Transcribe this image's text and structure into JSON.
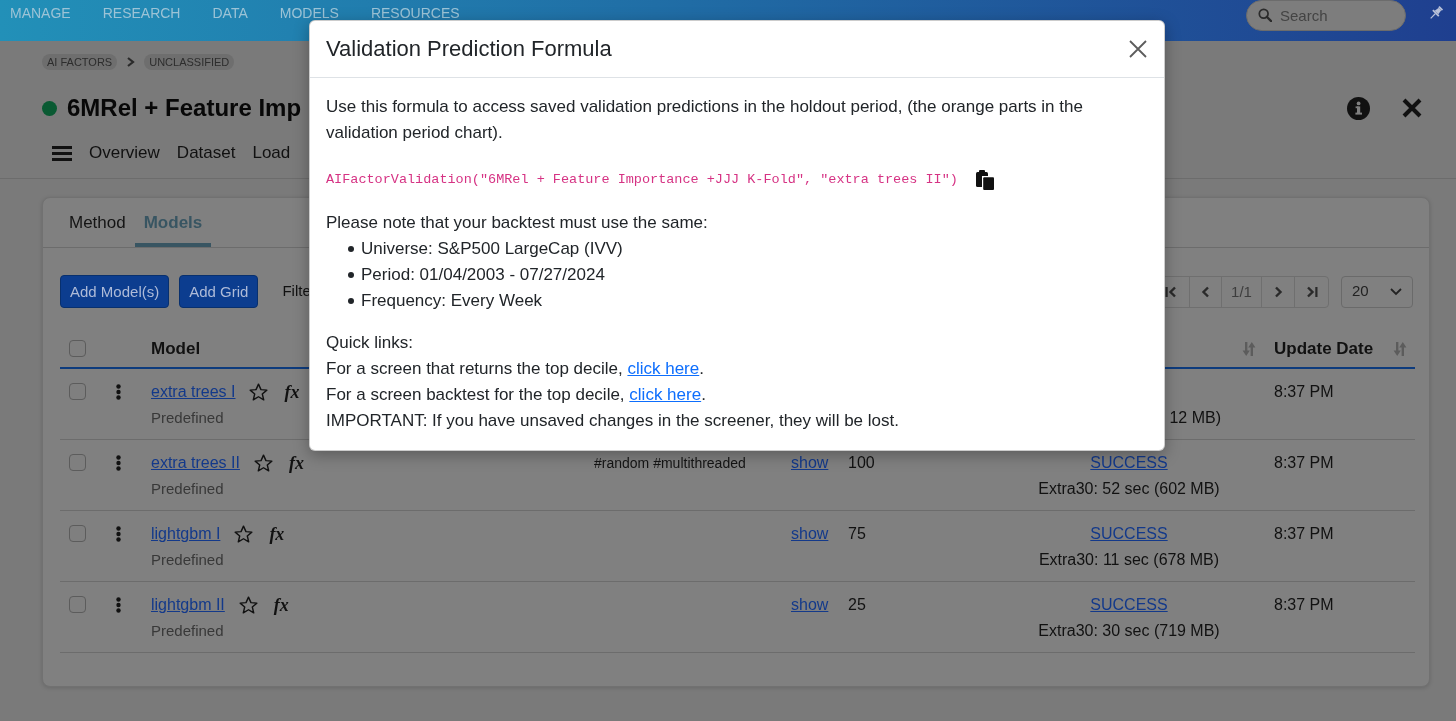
{
  "navbar": {
    "items": [
      "MANAGE",
      "RESEARCH",
      "DATA",
      "MODELS",
      "RESOURCES"
    ],
    "search": {
      "placeholder": "Search"
    }
  },
  "breadcrumb": [
    "AI FACTORS",
    "UNCLASSIFIED"
  ],
  "page": {
    "title": "6MRel + Feature Imp",
    "tabs": [
      "Overview",
      "Dataset",
      "Load"
    ]
  },
  "card": {
    "tabs": [
      {
        "label": "Method",
        "selected": false
      },
      {
        "label": "Models",
        "selected": true
      }
    ],
    "buttons": [
      "Add Model(s)",
      "Add Grid"
    ],
    "filter_label": "Filte",
    "pagination": {
      "page": "1/1",
      "page_size": "20"
    },
    "table": {
      "select_all_checked": false,
      "columns": {
        "model": "Model",
        "update_date": "Update Date"
      },
      "rows": [
        {
          "checked": false,
          "model": "extra trees I",
          "starred": false,
          "formula": "fx",
          "source": "Predefined",
          "column_7_detail": "12 MB)",
          "update_date": "8:37 PM"
        },
        {
          "checked": false,
          "model": "extra trees II",
          "starred": false,
          "formula": "fx",
          "source": "Predefined",
          "column_4": "#random #multithreaded",
          "column_5": "show",
          "column_6": "100",
          "column_7_link": "SUCCESS",
          "column_7_detail": "Extra30: 52 sec (602 MB)",
          "update_date": "8:37 PM"
        },
        {
          "checked": false,
          "model": "lightgbm I",
          "starred": false,
          "formula": "fx",
          "source": "Predefined",
          "column_5": "show",
          "column_6": "75",
          "column_7_link": "SUCCESS",
          "column_7_detail": "Extra30: 11 sec (678 MB)",
          "update_date": "8:37 PM"
        },
        {
          "checked": false,
          "model": "lightgbm II",
          "starred": false,
          "formula": "fx",
          "source": "Predefined",
          "column_5": "show",
          "column_6": "25",
          "column_7_link": "SUCCESS",
          "column_7_detail": "Extra30: 30 sec (719 MB)",
          "update_date": "8:37 PM"
        }
      ]
    }
  },
  "modal": {
    "title": "Validation Prediction Formula",
    "intro": "Use this formula to access saved validation predictions in the holdout period, (the orange parts in the validation period chart).",
    "formula": "AIFactorValidation(\"6MRel + Feature Importance +JJJ K-Fold\", \"extra trees II\")",
    "note": "Please note that your backtest must use the same:",
    "requirements": [
      "Universe: S&P500 LargeCap (IVV)",
      "Period: 01/04/2003 - 07/27/2024",
      "Frequency: Every Week"
    ],
    "quick_links_heading": "Quick links:",
    "quick_links": [
      {
        "before": "For a screen that returns the top decile, ",
        "link": "click here",
        "after": "."
      },
      {
        "before": "For a screen backtest for the top decile, ",
        "link": "click here",
        "after": "."
      }
    ],
    "warning": "IMPORTANT: If you have unsaved changes in the screener, they will be lost."
  }
}
